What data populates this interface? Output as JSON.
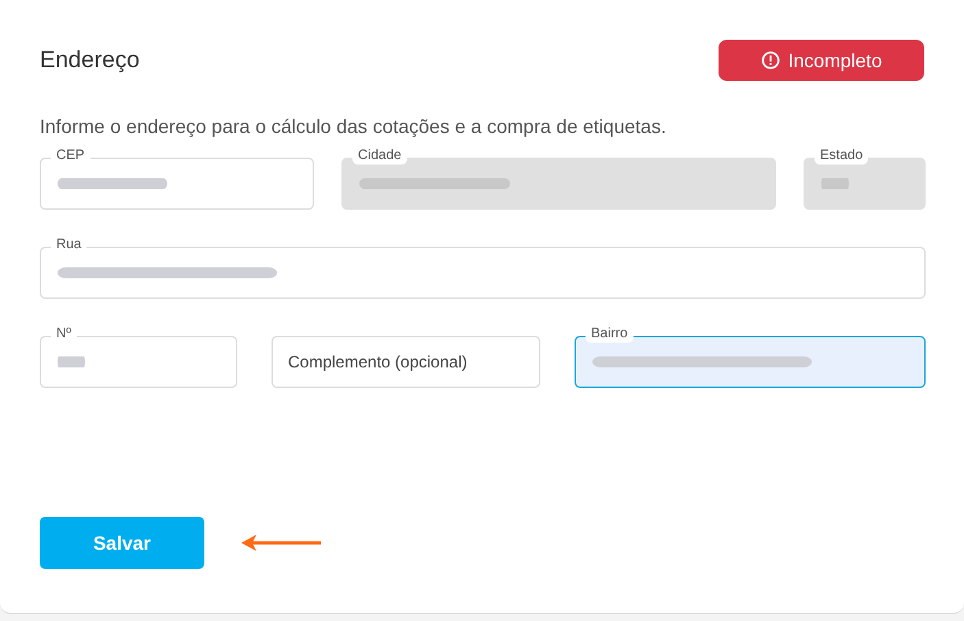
{
  "title": "Endereço",
  "status_badge": {
    "label": "Incompleto"
  },
  "description": "Informe o endereço para o cálculo das cotações e a compra de etiquetas.",
  "field_rows": [
    [
      {
        "kind": "blurred",
        "label": "CEP",
        "disabled": false,
        "focused": false
      },
      {
        "kind": "blurred",
        "label": "Cidade",
        "disabled": true,
        "focused": false
      },
      {
        "kind": "blurred",
        "label": "Estado",
        "disabled": true,
        "focused": false
      }
    ],
    [
      {
        "kind": "blurred",
        "label": "Rua",
        "disabled": false,
        "focused": false
      }
    ],
    [
      {
        "kind": "blurred",
        "label": "Nº",
        "disabled": false,
        "focused": false
      },
      {
        "kind": "empty",
        "placeholder": "Complemento (opcional)",
        "disabled": false,
        "focused": false
      },
      {
        "kind": "blurred",
        "label": "Bairro",
        "disabled": false,
        "focused": true
      }
    ]
  ],
  "save_button": "Salvar"
}
